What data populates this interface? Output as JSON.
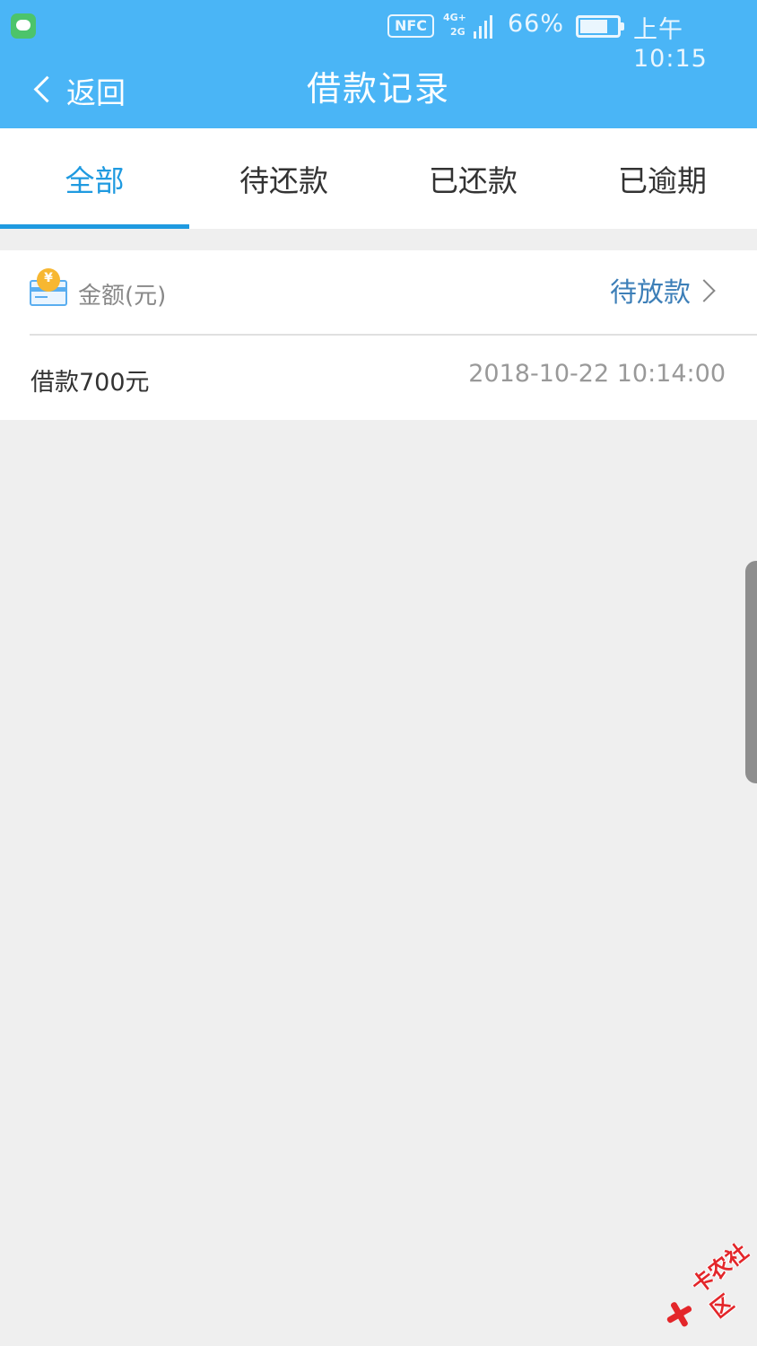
{
  "status_bar": {
    "nfc_label": "NFC",
    "network_top": "4G+",
    "network_bottom": "2G",
    "battery_percent": "66%",
    "battery_level": 0.66,
    "time": "上午10:15",
    "app_icon": "message-app-icon"
  },
  "title_bar": {
    "back_label": "返回",
    "back_icon": "chevron-left-icon",
    "title": "借款记录"
  },
  "tabs": [
    {
      "label": "全部",
      "active": true
    },
    {
      "label": "待还款",
      "active": false
    },
    {
      "label": "已还款",
      "active": false
    },
    {
      "label": "已逾期",
      "active": false
    }
  ],
  "record": {
    "icon": "wallet-icon",
    "coin_symbol": "¥",
    "amount_label": "金额(元)",
    "status": "待放款",
    "description": "借款700元",
    "datetime": "2018-10-22 10:14:00"
  },
  "watermark": {
    "text": "卡农社区"
  },
  "colors": {
    "header": "#4ab5f6",
    "accent": "#1f9ae0",
    "status_text": "#3d7fb8",
    "background": "#efefef"
  }
}
